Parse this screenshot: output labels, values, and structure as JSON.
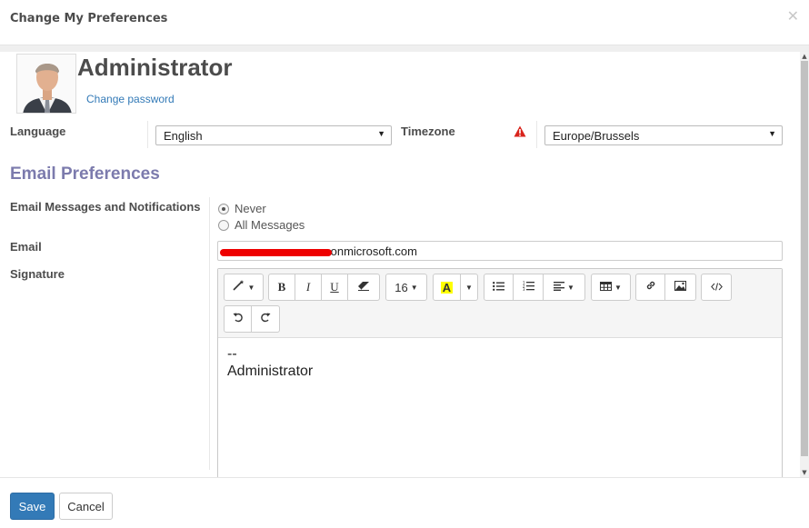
{
  "dialog": {
    "title": "Change My Preferences",
    "close_icon": "close-icon"
  },
  "profile": {
    "name": "Administrator",
    "change_password_label": "Change password"
  },
  "language": {
    "label": "Language",
    "value": "English"
  },
  "timezone": {
    "label": "Timezone",
    "value": "Europe/Brussels",
    "warning_icon": "warning-icon",
    "warning_color": "#d9241c"
  },
  "email_preferences": {
    "section_title": "Email Preferences",
    "notifications_label": "Email Messages and Notifications",
    "options": [
      {
        "label": "Never",
        "selected": true
      },
      {
        "label": "All Messages",
        "selected": false
      }
    ],
    "email_label": "Email",
    "email_visible_suffix": ".onmicrosoft.com",
    "signature_label": "Signature"
  },
  "editor": {
    "font_size": "16",
    "content_lines": [
      "--",
      "Administrator"
    ],
    "highlight_color": "#ffff00"
  },
  "footer": {
    "save_label": "Save",
    "cancel_label": "Cancel"
  },
  "colors": {
    "primary": "#337ab7",
    "section_title": "#7c7bad",
    "link": "#337ab7"
  }
}
